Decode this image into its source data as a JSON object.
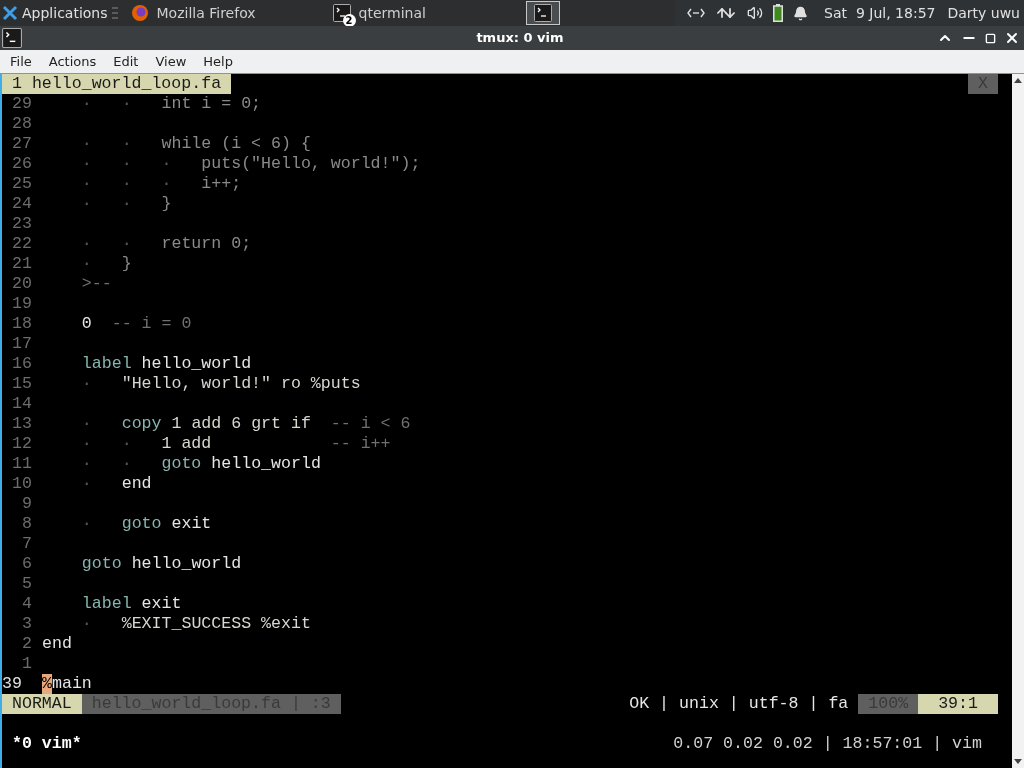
{
  "taskbar": {
    "launcher": "Applications",
    "tasks": [
      {
        "kind": "browser",
        "label": "Mozilla Firefox",
        "selected": false
      },
      {
        "kind": "terminal",
        "label": "qterminal",
        "badge": "2",
        "selected": false
      },
      {
        "kind": "terminal",
        "selected": true
      }
    ],
    "clock": "Sat  9 Jul, 18:57",
    "user": "Darty uwu"
  },
  "window": {
    "title": "tmux: 0 vim",
    "menu": [
      "File",
      "Actions",
      "Edit",
      "View",
      "Help"
    ]
  },
  "editor": {
    "tab": {
      "label": "1 hello_world_loop.fa",
      "close": "X"
    },
    "lines": [
      {
        "number": "29",
        "current": false,
        "segments": [
          {
            "kind": "indent",
            "text": "    ·   ·   "
          },
          {
            "kind": "embedded",
            "text": "int i = 0;"
          }
        ]
      },
      {
        "number": "28",
        "current": false
      },
      {
        "number": "27",
        "current": false,
        "segments": [
          {
            "kind": "indent",
            "text": "    ·   ·   "
          },
          {
            "kind": "embedded",
            "text": "while (i < 6) {"
          }
        ]
      },
      {
        "number": "26",
        "current": false,
        "segments": [
          {
            "kind": "indent",
            "text": "    ·   ·   ·   "
          },
          {
            "kind": "embedded",
            "text": "puts(\"Hello, world!\");"
          }
        ]
      },
      {
        "number": "25",
        "current": false,
        "segments": [
          {
            "kind": "indent",
            "text": "    ·   ·   ·   "
          },
          {
            "kind": "embedded",
            "text": "i++;"
          }
        ]
      },
      {
        "number": "24",
        "current": false,
        "segments": [
          {
            "kind": "indent",
            "text": "    ·   ·   "
          },
          {
            "kind": "embedded",
            "text": "}"
          }
        ]
      },
      {
        "number": "23",
        "current": false
      },
      {
        "number": "22",
        "current": false,
        "segments": [
          {
            "kind": "indent",
            "text": "    ·   ·   "
          },
          {
            "kind": "embedded",
            "text": "return 0;"
          }
        ]
      },
      {
        "number": "21",
        "current": false,
        "segments": [
          {
            "kind": "indent",
            "text": "    ·   "
          },
          {
            "kind": "embedded",
            "text": "}"
          }
        ]
      },
      {
        "number": "20",
        "current": false,
        "segments": [
          {
            "kind": "comment",
            "text": "    >--"
          }
        ]
      },
      {
        "number": "19",
        "current": false
      },
      {
        "number": "18",
        "current": false,
        "segments": [
          {
            "kind": "text",
            "text": "    0"
          },
          {
            "kind": "comment",
            "text": "  -- i = 0"
          }
        ]
      },
      {
        "number": "17",
        "current": false
      },
      {
        "number": "16",
        "current": false,
        "segments": [
          {
            "kind": "keyword",
            "text": "    label"
          },
          {
            "kind": "text",
            "text": " hello_world"
          }
        ]
      },
      {
        "number": "15",
        "current": false,
        "segments": [
          {
            "kind": "indent",
            "text": "    ·   "
          },
          {
            "kind": "string",
            "text": "\"Hello, world!\" ro %puts"
          }
        ]
      },
      {
        "number": "14",
        "current": false
      },
      {
        "number": "13",
        "current": false,
        "segments": [
          {
            "kind": "indent",
            "text": "    ·   "
          },
          {
            "kind": "keyword",
            "text": "copy"
          },
          {
            "kind": "string",
            "text": " 1 add 6 grt if"
          },
          {
            "kind": "comment",
            "text": "  -- i < 6"
          }
        ]
      },
      {
        "number": "12",
        "current": false,
        "segments": [
          {
            "kind": "indent",
            "text": "    ·   ·   "
          },
          {
            "kind": "string",
            "text": "1 add"
          },
          {
            "kind": "comment",
            "text": "            -- i++"
          }
        ]
      },
      {
        "number": "11",
        "current": false,
        "segments": [
          {
            "kind": "indent",
            "text": "    ·   ·   "
          },
          {
            "kind": "keyword",
            "text": "goto"
          },
          {
            "kind": "text",
            "text": " hello_world"
          }
        ]
      },
      {
        "number": "10",
        "current": false,
        "segments": [
          {
            "kind": "indent",
            "text": "    ·   "
          },
          {
            "kind": "text",
            "text": "end"
          }
        ]
      },
      {
        "number": "9",
        "current": false
      },
      {
        "number": "8",
        "current": false,
        "segments": [
          {
            "kind": "indent",
            "text": "    ·   "
          },
          {
            "kind": "keyword",
            "text": "goto"
          },
          {
            "kind": "text",
            "text": " exit"
          }
        ]
      },
      {
        "number": "7",
        "current": false
      },
      {
        "number": "6",
        "current": false,
        "segments": [
          {
            "kind": "keyword",
            "text": "    goto"
          },
          {
            "kind": "text",
            "text": " hello_world"
          }
        ]
      },
      {
        "number": "5",
        "current": false
      },
      {
        "number": "4",
        "current": false,
        "segments": [
          {
            "kind": "keyword",
            "text": "    label"
          },
          {
            "kind": "text",
            "text": " exit"
          }
        ]
      },
      {
        "number": "3",
        "current": false,
        "segments": [
          {
            "kind": "indent",
            "text": "    ·   "
          },
          {
            "kind": "string",
            "text": "%EXIT_SUCCESS %exit"
          }
        ]
      },
      {
        "number": "2",
        "current": false,
        "segments": [
          {
            "kind": "text",
            "text": "end"
          }
        ]
      },
      {
        "number": "1",
        "current": false
      },
      {
        "number": "39",
        "current": true,
        "segments": [
          {
            "kind": "cursor",
            "text": "%"
          },
          {
            "kind": "text",
            "text": "main"
          }
        ]
      }
    ],
    "statusline": {
      "mode": "NORMAL",
      "file": "hello_world_loop.fa | :3",
      "info": "OK | unix | utf-8 | fa",
      "percent": "100%",
      "position": "39:1"
    }
  },
  "tmux": {
    "windows": "*0 vim*",
    "status": "0.07 0.02 0.02 | 18:57:01 | vim"
  }
}
